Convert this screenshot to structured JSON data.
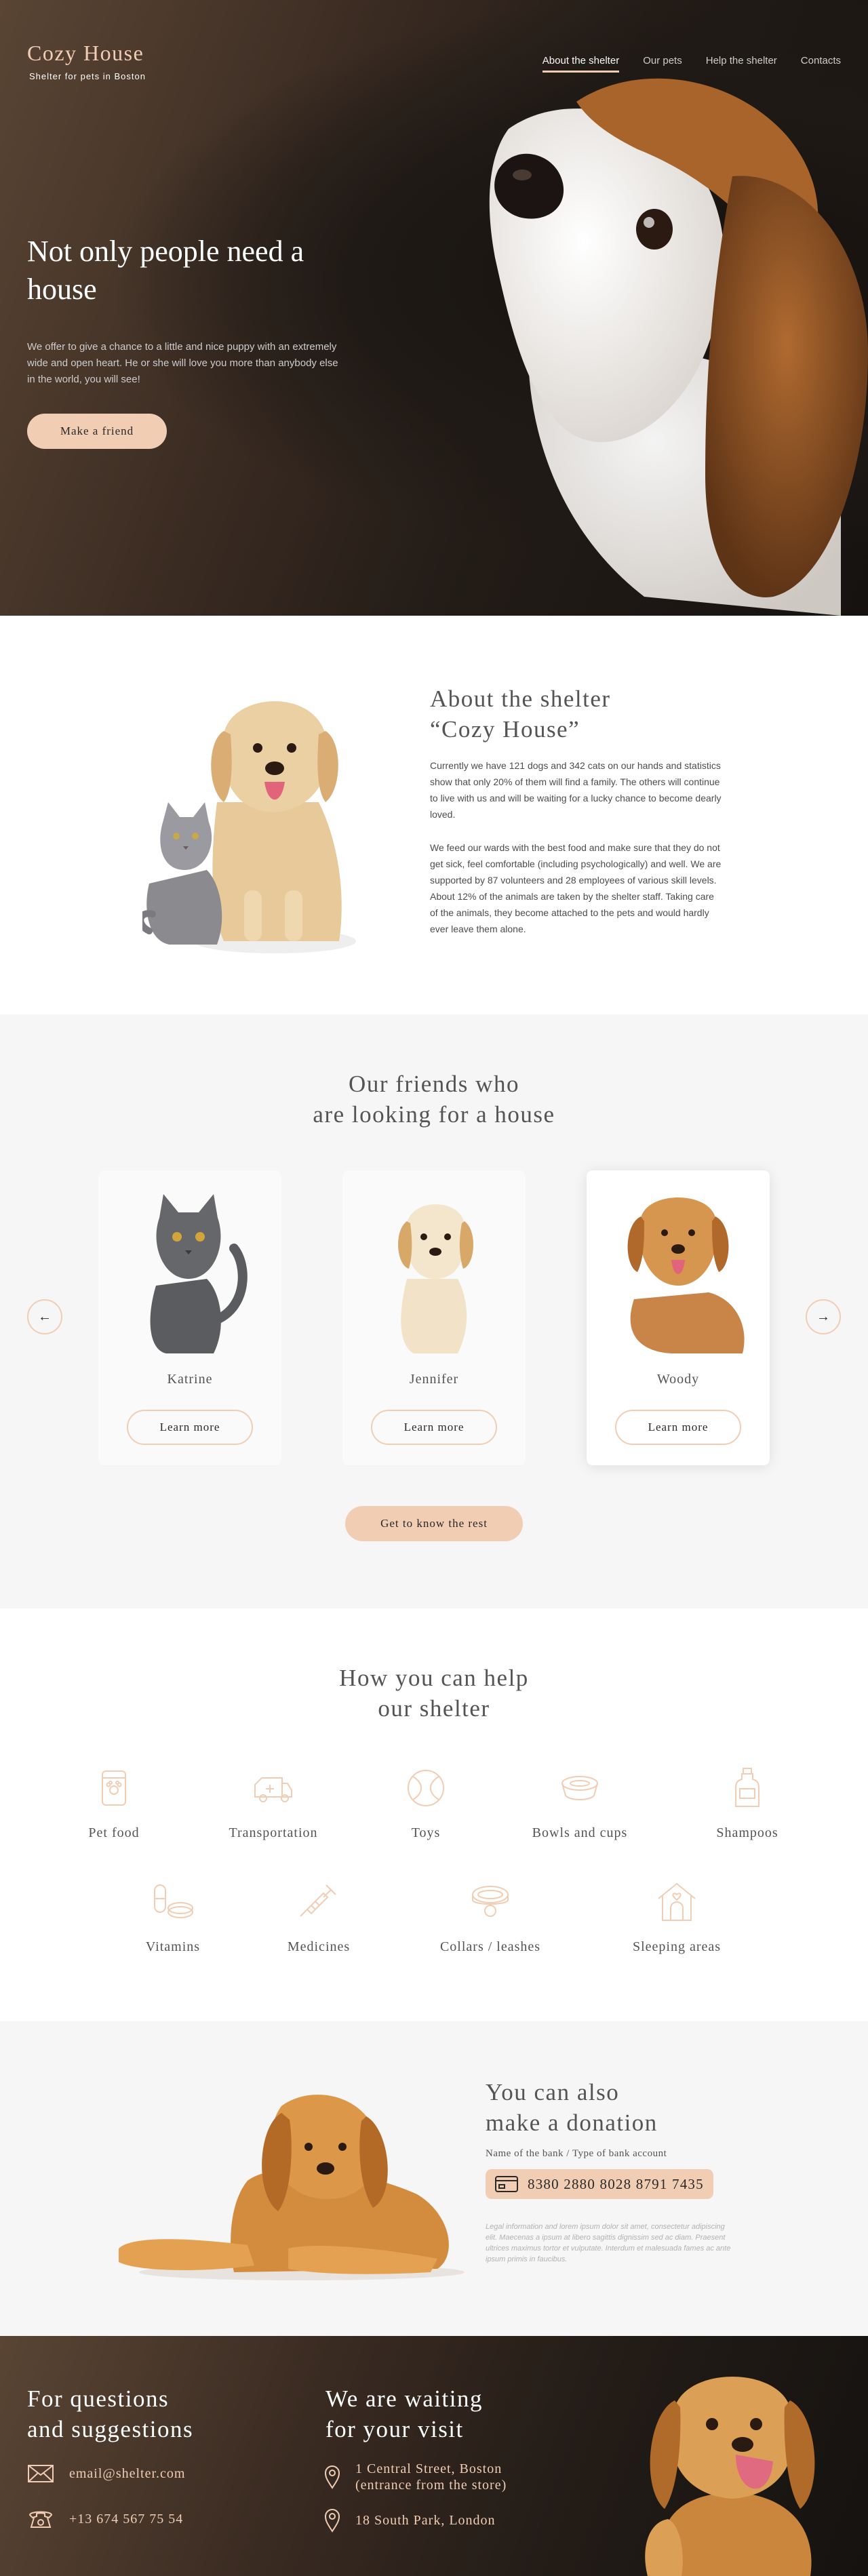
{
  "header": {
    "logo_title": "Cozy House",
    "logo_subtitle": "Shelter for pets in Boston",
    "nav": [
      "About the shelter",
      "Our pets",
      "Help the shelter",
      "Contacts"
    ],
    "active_nav": "About the shelter"
  },
  "hero": {
    "title": "Not only people need a house",
    "text": "We offer to give a chance to a little and nice puppy with an extremely wide and open heart. He or she will love you more than anybody else in the world, you will see!",
    "button": "Make a friend"
  },
  "about": {
    "title_line1": "About the shelter",
    "title_line2": "“Cozy House”",
    "p1": "Currently we have 121 dogs and 342 cats on our hands and statistics show that only 20% of them will find a family. The others will continue to live with us and will be waiting for a lucky chance to become dearly loved.",
    "p2": "We feed our wards with the best food and make sure that they do not get sick, feel comfortable (including psychologically) and well. We are supported by 87 volunteers and 28 employees of various skill levels. About 12% of the animals are taken by the shelter staff. Taking care of the animals, they become attached to the pets and would hardly ever leave them alone."
  },
  "pets": {
    "title_line1": "Our friends who",
    "title_line2": "are looking for a house",
    "cards": [
      {
        "name": "Katrine",
        "button": "Learn more"
      },
      {
        "name": "Jennifer",
        "button": "Learn more"
      },
      {
        "name": "Woody",
        "button": "Learn more"
      }
    ],
    "arrow_left": "←",
    "arrow_right": "→",
    "cta": "Get to know the rest"
  },
  "help": {
    "title_line1": "How you can help",
    "title_line2": "our shelter",
    "items": [
      "Pet food",
      "Transportation",
      "Toys",
      "Bowls and cups",
      "Shampoos",
      "Vitamins",
      "Medicines",
      "Collars / leashes",
      "Sleeping areas"
    ]
  },
  "donation": {
    "title_line1": "You can also",
    "title_line2": "make a donation",
    "bank_label": "Name of the bank / Type of bank account",
    "card_number": "8380 2880 8028 8791 7435",
    "legal": "Legal information and lorem ipsum dolor sit amet, consectetur adipiscing elit. Maecenas a ipsum at libero sagittis dignissim sed ac diam. Praesent ultrices maximus tortor et vulputate. Interdum et malesuada fames ac ante ipsum primis in faucibus."
  },
  "footer": {
    "q_title_line1": "For questions",
    "q_title_line2": "and suggestions",
    "email": "email@shelter.com",
    "phone": "+13 674 567 75 54",
    "v_title_line1": "We are waiting",
    "v_title_line2": "for your visit",
    "address1_line1": "1 Central Street, Boston",
    "address1_line2": "(entrance from the store)",
    "address2": "18 South Park, London"
  },
  "colors": {
    "accent": "#f1cdb3",
    "dark_bg": "#211f20",
    "light_bg": "#f6f6f6",
    "text": "#545454"
  }
}
